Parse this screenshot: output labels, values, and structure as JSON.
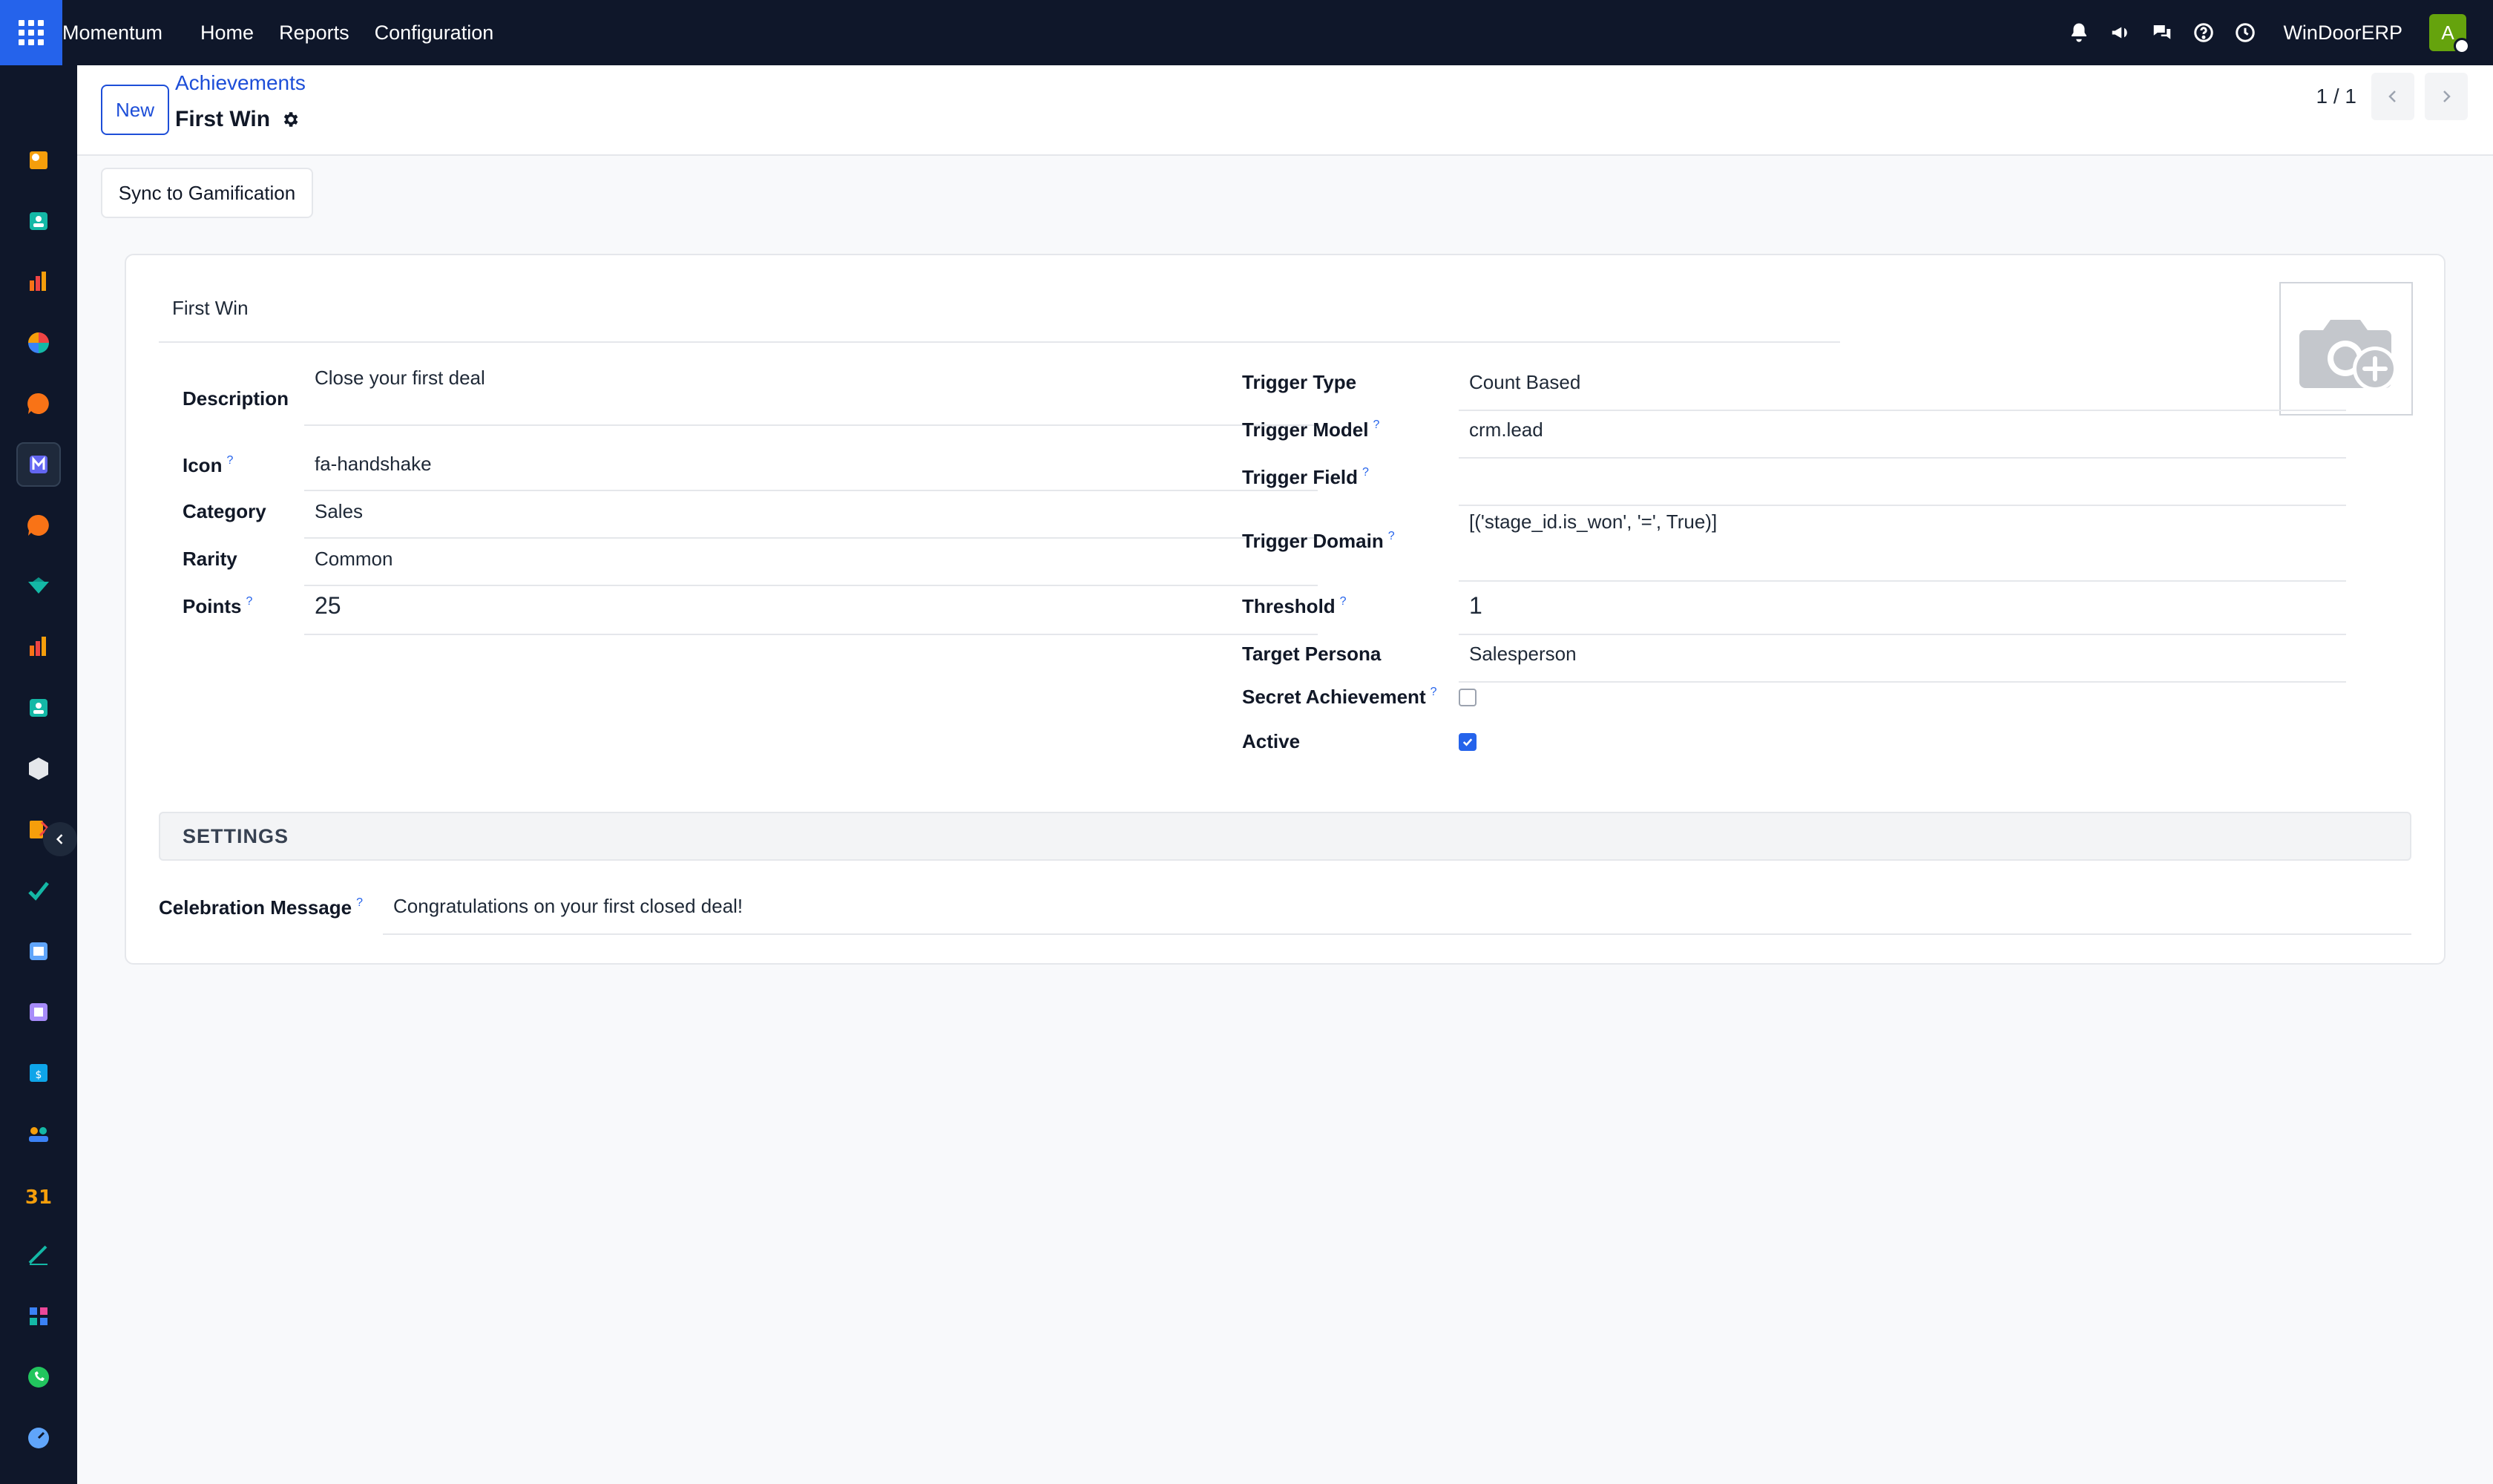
{
  "topbar": {
    "brand": "Momentum",
    "menu": [
      "Home",
      "Reports",
      "Configuration"
    ],
    "company": "WinDoorERP",
    "avatar_letter": "A",
    "icons": [
      "bell-icon",
      "megaphone-icon",
      "chat-icon",
      "help-icon",
      "clock-icon"
    ]
  },
  "sidebar": {
    "items": [
      {
        "name": "app-icon-1",
        "color": "#f59e0b"
      },
      {
        "name": "contacts-app-icon",
        "color": "#14b8a6"
      },
      {
        "name": "reports-app-icon",
        "color": "#f97316"
      },
      {
        "name": "pie-app-icon",
        "color": "#ef4444"
      },
      {
        "name": "discuss-app-icon",
        "color": "#f97316"
      },
      {
        "name": "momentum-app-icon",
        "color": "#6366f1"
      },
      {
        "name": "chat-app-icon",
        "color": "#f97316"
      },
      {
        "name": "sales-app-icon",
        "color": "#14b8a6"
      },
      {
        "name": "dashboard-app-icon",
        "color": "#f97316"
      },
      {
        "name": "employees-app-icon",
        "color": "#14b8a6"
      },
      {
        "name": "inventory-app-icon",
        "color": "#e5e7eb"
      },
      {
        "name": "tools-app-icon",
        "color": "#f59e0b"
      },
      {
        "name": "project-app-icon",
        "color": "#14b8a6"
      },
      {
        "name": "knowledge-app-icon",
        "color": "#60a5fa"
      },
      {
        "name": "apps-store-icon",
        "color": "#a78bfa"
      },
      {
        "name": "invoicing-app-icon",
        "color": "#0ea5e9"
      },
      {
        "name": "team-app-icon",
        "color": "#f59e0b"
      },
      {
        "name": "calendar-app-icon",
        "color": "#f59e0b"
      },
      {
        "name": "sign-app-icon",
        "color": "#14b8a6"
      },
      {
        "name": "website-app-icon",
        "color": "#3b82f6"
      },
      {
        "name": "whatsapp-app-icon",
        "color": "#22c55e"
      },
      {
        "name": "timer-app-icon",
        "color": "#60a5fa"
      },
      {
        "name": "marketing-app-icon",
        "color": "#0ea5e9"
      }
    ]
  },
  "control": {
    "new_label": "New",
    "breadcrumb": "Achievements",
    "record_title": "First Win",
    "pager": "1 / 1"
  },
  "actions": {
    "sync_label": "Sync to Gamification"
  },
  "form": {
    "name": "First Win",
    "left": {
      "description_label": "Description",
      "description_value": "Close your first deal",
      "icon_label": "Icon",
      "icon_value": "fa-handshake",
      "category_label": "Category",
      "category_value": "Sales",
      "rarity_label": "Rarity",
      "rarity_value": "Common",
      "points_label": "Points",
      "points_value": "25"
    },
    "right": {
      "trigger_type_label": "Trigger Type",
      "trigger_type_value": "Count Based",
      "trigger_model_label": "Trigger Model",
      "trigger_model_value": "crm.lead",
      "trigger_field_label": "Trigger Field",
      "trigger_field_value": "",
      "trigger_domain_label": "Trigger Domain",
      "trigger_domain_value": "[('stage_id.is_won', '=', True)]",
      "threshold_label": "Threshold",
      "threshold_value": "1",
      "target_persona_label": "Target Persona",
      "target_persona_value": "Salesperson",
      "secret_label": "Secret Achievement",
      "secret_checked": false,
      "active_label": "Active",
      "active_checked": true
    },
    "help_mark": "?",
    "settings_title": "SETTINGS",
    "celebration_label": "Celebration Message",
    "celebration_value": "Congratulations on your first closed deal!"
  },
  "colors": {
    "accent": "#2563eb",
    "topbar": "#0f172a"
  }
}
